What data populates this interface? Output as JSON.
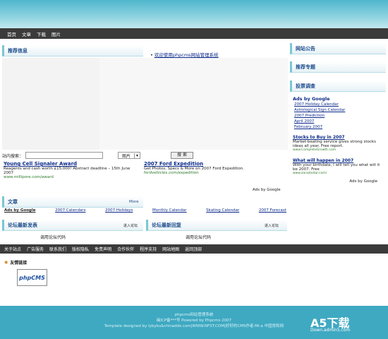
{
  "nav": {
    "items": [
      "首页",
      "文章",
      "下载",
      "图片"
    ]
  },
  "recommend": {
    "title": "推荐信息",
    "link": "欢迎使用phpcms网站管理系统"
  },
  "search": {
    "label": "站内搜索：",
    "select": "图片",
    "button": "搜 索"
  },
  "ads_top": [
    {
      "title": "Young Cell Signaler Award",
      "text": "Reagents and cash worth £15,000! Abstract deadline – 15th June 2007",
      "url": "www.millipore.com/award"
    },
    {
      "title": "2007 Ford Expedition",
      "text": "Get Photos, Specs & More on 2007 Ford Expedition.",
      "url": "fordvehicles.com/expedition"
    }
  ],
  "ads_by_google": "Ads by Google",
  "articles": {
    "title": "文章",
    "more": "More",
    "links": [
      "Ads by Google",
      "2007 Calendars",
      "2007 Holidays",
      "Monthly Calendar",
      "Skating Calendar",
      "2007 Forecast"
    ]
  },
  "forum_new": {
    "title": "论坛最新发表",
    "enter": "进入论坛",
    "code": "调用论坛代码"
  },
  "forum_reply": {
    "title": "论坛最新回复",
    "enter": "进入论坛",
    "code": "调用论坛代码"
  },
  "side": {
    "notice": "网站公告",
    "special": "推荐专题",
    "vote": "投票调查",
    "ads_title": "Ads by Google",
    "ads_links": [
      "2007 Holiday Calendar",
      "Astrological Sign Calendar",
      "2007 Prediction",
      "April 2007",
      "February 2007"
    ],
    "ad1": {
      "title": "Stocks to Buy in 2007",
      "text": "Market-beating service gives strong stocks ideas all year. Free report.",
      "url": "www.CompleteGrowth.com"
    },
    "ad2": {
      "title": "What will happen in 2007",
      "text": "With your birthdate, I will tell you what will it be 2007. Free",
      "url": "www.zarastedar.com/"
    },
    "ads_by": "Ads by Google"
  },
  "footer_nav": [
    "关于站点",
    "广告服务",
    "联系我们",
    "版权隐私",
    "免责声明",
    "合作伙伴",
    "程序支持",
    "网站地图",
    "返回顶部"
  ],
  "links": {
    "title": "友情链接",
    "logo_text": "phpCMS"
  },
  "footer": {
    "line1": "phpcms网站管理系统",
    "line2": "闽ICP备***号   Powered by Phpcms 2007",
    "line3": "Template designed by lybyku&chinadds.com|WWW.NFST.COM|好好的CMS作者:Mr.a  中国党和网",
    "watermark": "A5下载",
    "watermark2": "Down.admin5.com"
  }
}
